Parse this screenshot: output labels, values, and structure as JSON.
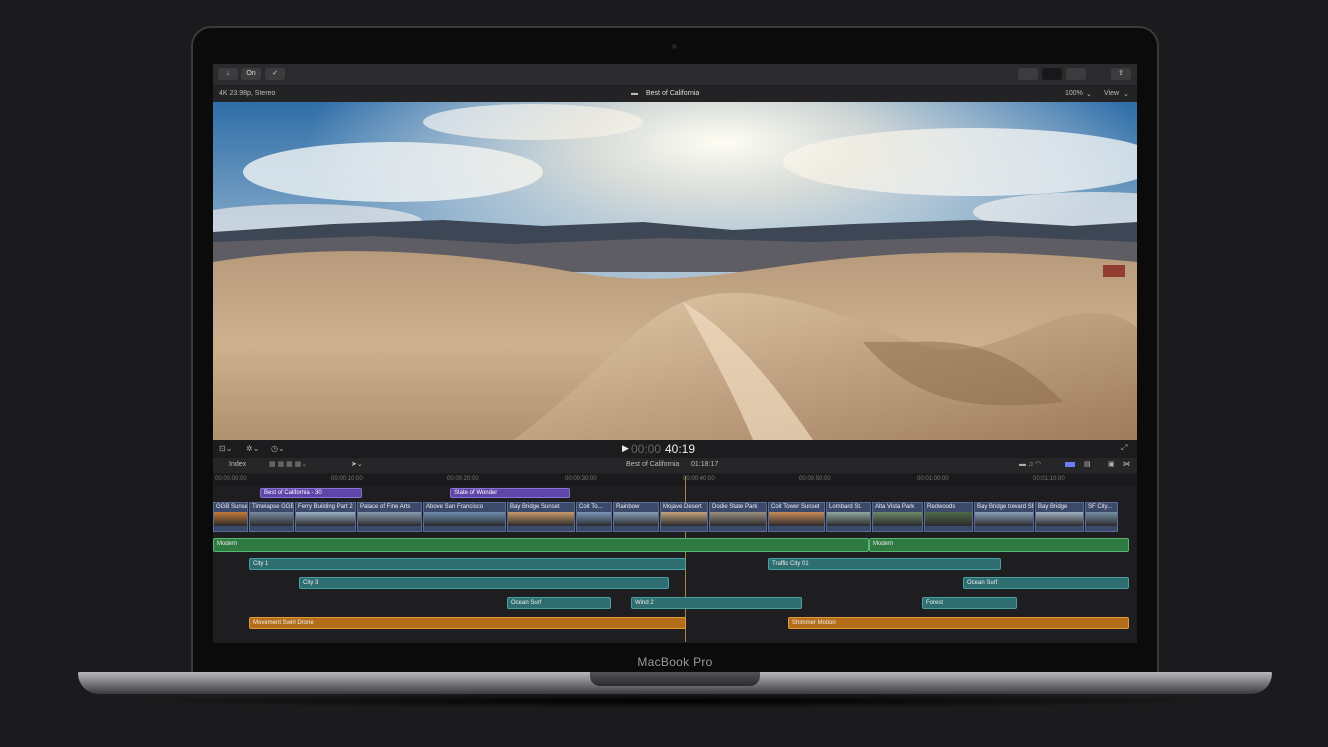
{
  "device": {
    "brand": "MacBook Pro"
  },
  "toolbar": {
    "import_label": "↓",
    "keyword_label": "On",
    "check_label": "✓",
    "share_icon": "share-icon"
  },
  "viewer": {
    "format": "4K 23.98p, Stereo",
    "title": "Best of California",
    "zoom": "100%",
    "view_label": "View",
    "timecode_dim": "00:00",
    "timecode": "40:19"
  },
  "timeline": {
    "index_label": "Index",
    "project_name": "Best of California",
    "duration": "01:18:17",
    "ruler": [
      "00:00:00:00",
      "00:00:10:00",
      "00:00:20:00",
      "00:00:30:00",
      "00:00:40:00",
      "00:00:50:00",
      "00:01:00:00",
      "00:01:10:00"
    ],
    "markers": [
      {
        "label": "Best of California - 30"
      },
      {
        "label": "State of Wonder"
      }
    ],
    "clips": [
      {
        "label": "GGB Sunset"
      },
      {
        "label": "Timelapse GGB"
      },
      {
        "label": "Ferry Building Part 2"
      },
      {
        "label": "Palace of Fine Arts"
      },
      {
        "label": "Above San Francisco"
      },
      {
        "label": "Bay Bridge Sunset"
      },
      {
        "label": "Coit To..."
      },
      {
        "label": "Rainbow"
      },
      {
        "label": "Mojave Desert"
      },
      {
        "label": "Dodie State Park"
      },
      {
        "label": "Coit Tower Sunset"
      },
      {
        "label": "Lombard St."
      },
      {
        "label": "Alta Vista Park"
      },
      {
        "label": "Redwoods"
      },
      {
        "label": "Bay Bridge toward SF"
      },
      {
        "label": "Bay Bridge"
      },
      {
        "label": "SF City..."
      }
    ],
    "music": [
      {
        "label": "Modern"
      },
      {
        "label": "Modern"
      }
    ],
    "audio": [
      {
        "label": "City 1"
      },
      {
        "label": "Traffic City 01"
      },
      {
        "label": "City 3"
      },
      {
        "label": "Ocean Surf"
      },
      {
        "label": "Ocean Surf"
      },
      {
        "label": "Wind 2"
      },
      {
        "label": "Forest"
      },
      {
        "label": "Movement Swirl Drone"
      },
      {
        "label": "Shimmer Motion"
      }
    ]
  }
}
